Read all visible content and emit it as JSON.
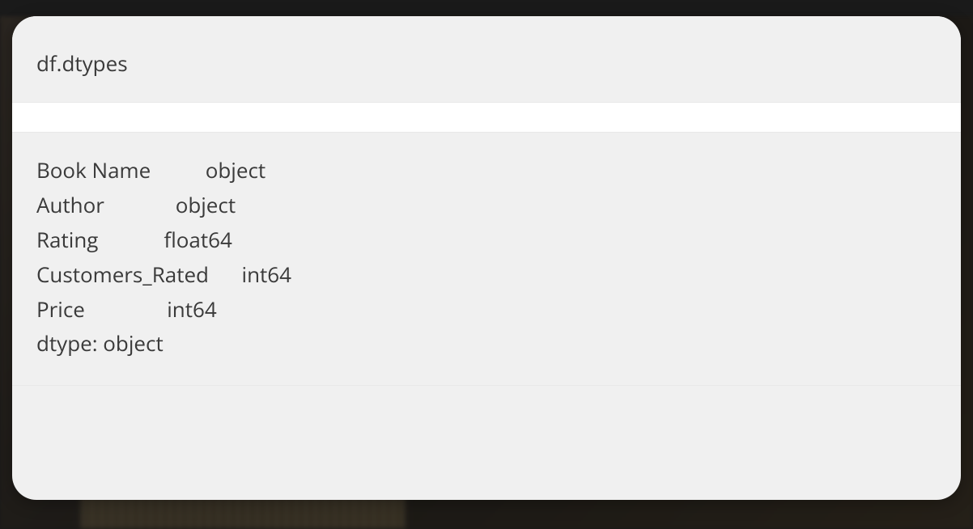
{
  "cell": {
    "input_code": "df.dtypes",
    "output": {
      "columns": [
        {
          "name": "Book Name",
          "dtype": "object"
        },
        {
          "name": "Author",
          "dtype": "object"
        },
        {
          "name": "Rating",
          "dtype": "float64"
        },
        {
          "name": "Customers_Rated",
          "dtype": "int64"
        },
        {
          "name": "Price",
          "dtype": "int64"
        }
      ],
      "footer": "dtype: object"
    }
  }
}
